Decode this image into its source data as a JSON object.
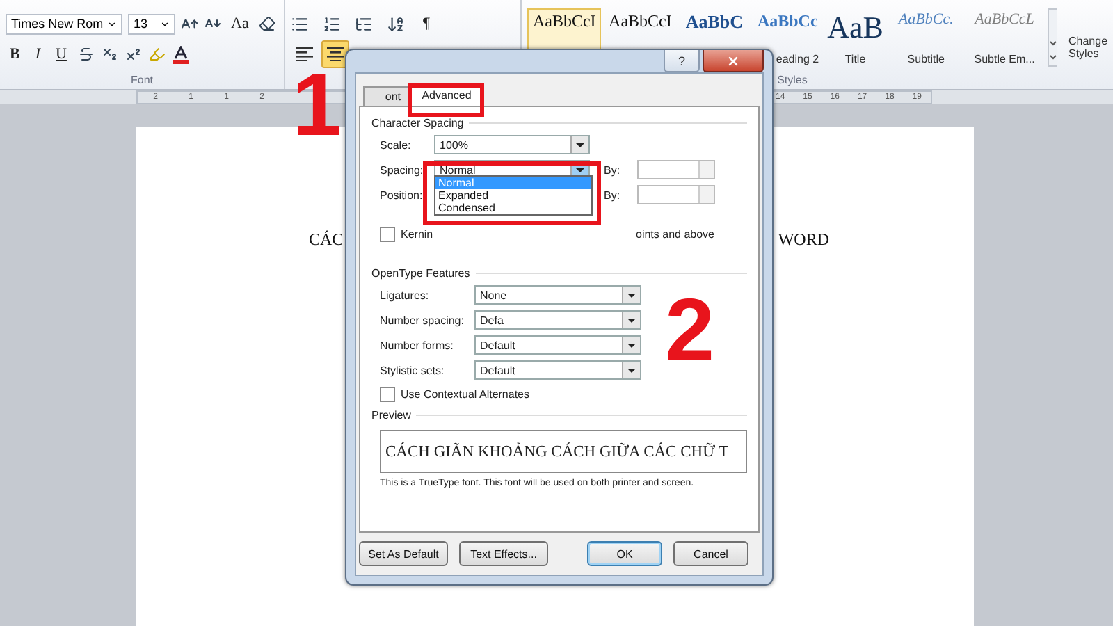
{
  "ribbon": {
    "font_group": {
      "font_name": "Times New Rom",
      "font_size": "13",
      "change_case": "Aa",
      "bold": "B",
      "italic": "I",
      "underline": "U",
      "label": "Font"
    },
    "paragraph_group": {
      "pilcrow": "¶",
      "alignments": [
        {
          "kind": "left",
          "selected": false
        },
        {
          "kind": "center",
          "selected": true
        }
      ]
    },
    "styles_group": {
      "label": "Styles",
      "items": [
        {
          "kind": "normal",
          "sample": "AaBbCcI",
          "selected": true
        },
        {
          "kind": "no-spacing",
          "sample": "AaBbCcI",
          "selected": false
        },
        {
          "kind": "heading1",
          "sample": "AaBbC",
          "selected": false
        },
        {
          "kind": "heading2",
          "sample": "AaBbCc",
          "label": "eading 2",
          "selected": false
        },
        {
          "kind": "title",
          "sample": "AaB",
          "label": "Title",
          "selected": false
        },
        {
          "kind": "subtitle",
          "sample": "AaBbCc.",
          "label": "Subtitle",
          "selected": false
        },
        {
          "kind": "subtle",
          "sample": "AaBbCcL",
          "label": "Subtle Em...",
          "selected": false
        }
      ]
    },
    "change_styles": "Change Styles"
  },
  "ruler": {
    "left_numbers": [
      "2",
      "1",
      "1",
      "2"
    ],
    "right_numbers": [
      "14",
      "15",
      "16",
      "17",
      "18",
      "19"
    ]
  },
  "document": {
    "visible_text": [
      "CÁC",
      "WORD"
    ]
  },
  "dialog": {
    "help": "?",
    "tabs": [
      {
        "label": "ont",
        "selected": false
      },
      {
        "label": "Advanced",
        "selected": true
      }
    ],
    "character_spacing": {
      "title": "Character Spacing",
      "scale": {
        "label": "Scale:",
        "value": "100%"
      },
      "spacing": {
        "label": "Spacing:",
        "value": "Normal",
        "expanded": true,
        "by_label": "By:",
        "options": [
          {
            "label": "Normal",
            "selected": true
          },
          {
            "label": "Expanded",
            "selected": false
          },
          {
            "label": "Condensed",
            "selected": false
          }
        ]
      },
      "position": {
        "label": "Position:",
        "by_label": "By:"
      },
      "kerning": {
        "label": "Kernin",
        "checked": false,
        "suffix": "oints and above"
      }
    },
    "opentype": {
      "title": "OpenType Features",
      "rows": [
        {
          "label": "Ligatures:",
          "value": "None"
        },
        {
          "label": "Number spacing:",
          "value": "Defa"
        },
        {
          "label": "Number forms:",
          "value": "Default"
        },
        {
          "label": "Stylistic sets:",
          "value": "Default"
        }
      ],
      "contextual": {
        "label": "Use Contextual Alternates",
        "checked": false
      }
    },
    "preview": {
      "title": "Preview",
      "sample": "CÁCH GIÃN KHOẢNG CÁCH GIỮA CÁC CHỮ T",
      "note": "This is a TrueType font. This font will be used on both printer and screen."
    },
    "buttons": [
      {
        "label": "Set As Default",
        "default": false
      },
      {
        "label": "Text Effects...",
        "default": false
      },
      {
        "label": "OK",
        "default": true
      },
      {
        "label": "Cancel",
        "default": false
      }
    ]
  },
  "annotations": [
    {
      "text": "1",
      "kind": "tab"
    },
    {
      "text": "2",
      "kind": "dropdown"
    }
  ]
}
